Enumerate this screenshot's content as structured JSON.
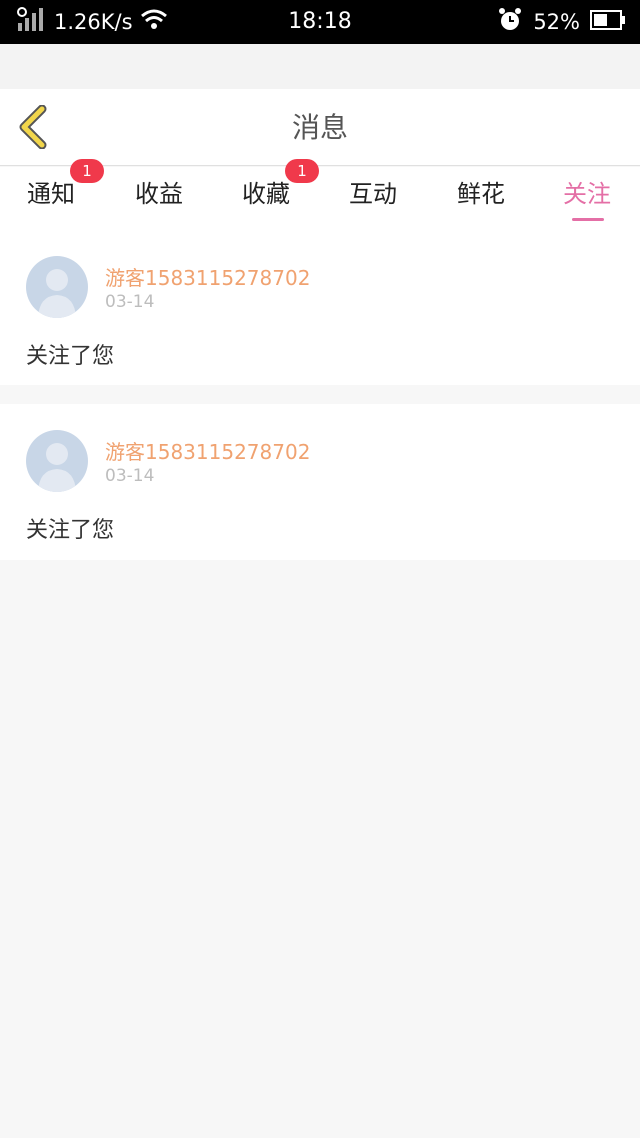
{
  "status_bar": {
    "network_speed": "1.26K/s",
    "time": "18:18",
    "battery": "52%",
    "icons": [
      "signal-icon",
      "wifi-icon",
      "alarm-icon",
      "battery-icon"
    ]
  },
  "header": {
    "title": "消息",
    "back_icon": "chevron-left-icon",
    "back_color": "#f2d64b"
  },
  "tabs": [
    {
      "label": "通知",
      "badge": "1"
    },
    {
      "label": "收益"
    },
    {
      "label": "收藏",
      "badge": "1"
    },
    {
      "label": "互动"
    },
    {
      "label": "鲜花"
    },
    {
      "label": "关注",
      "active": true
    }
  ],
  "colors": {
    "accent": "#e46fa6",
    "badge": "#f0394b",
    "username": "#f0a270"
  },
  "messages": [
    {
      "username": "游客1583115278702",
      "date": "03-14",
      "text": "关注了您"
    },
    {
      "username": "游客1583115278702",
      "date": "03-14",
      "text": "关注了您"
    }
  ]
}
